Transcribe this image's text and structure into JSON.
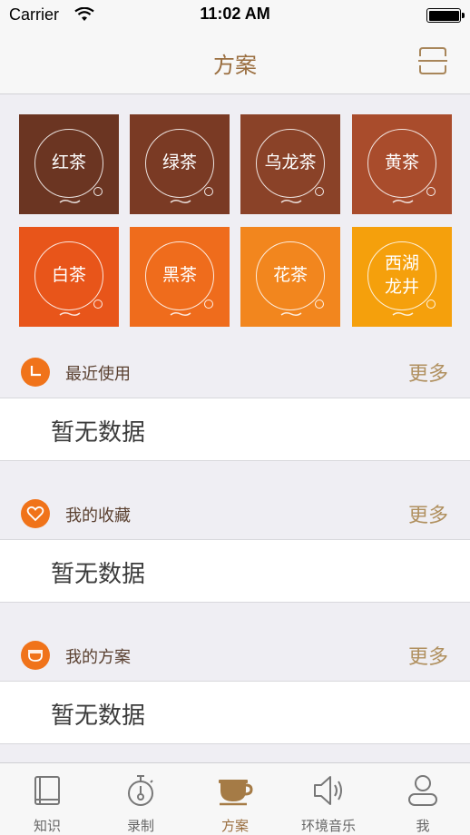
{
  "status_bar": {
    "carrier": "Carrier",
    "time": "11:02 AM"
  },
  "nav": {
    "title": "方案",
    "scan_icon": "scan-icon"
  },
  "teas": [
    {
      "label": "红茶",
      "color": "#6b3522"
    },
    {
      "label": "绿茶",
      "color": "#7a3a24"
    },
    {
      "label": "乌龙茶",
      "color": "#8a4228"
    },
    {
      "label": "黄茶",
      "color": "#a94c2c"
    },
    {
      "label": "白茶",
      "color": "#e8551a"
    },
    {
      "label": "黑茶",
      "color": "#ef6c1c"
    },
    {
      "label": "花茶",
      "color": "#f2861e"
    },
    {
      "label": "西湖\n龙井",
      "color": "#f5a00c"
    }
  ],
  "sections": [
    {
      "title": "最近使用",
      "more": "更多",
      "empty": "暂无数据",
      "icon": "clock-icon"
    },
    {
      "title": "我的收藏",
      "more": "更多",
      "empty": "暂无数据",
      "icon": "heart-icon"
    },
    {
      "title": "我的方案",
      "more": "更多",
      "empty": "暂无数据",
      "icon": "teacup-icon"
    }
  ],
  "tabs": [
    {
      "label": "知识",
      "icon": "book-icon"
    },
    {
      "label": "录制",
      "icon": "stopwatch-icon"
    },
    {
      "label": "方案",
      "icon": "coffee-cup-icon",
      "active": true
    },
    {
      "label": "环境音乐",
      "icon": "speaker-icon"
    },
    {
      "label": "我",
      "icon": "person-icon"
    }
  ],
  "colors": {
    "accent": "#9a6e3f",
    "section_icon": "#f0731a"
  }
}
